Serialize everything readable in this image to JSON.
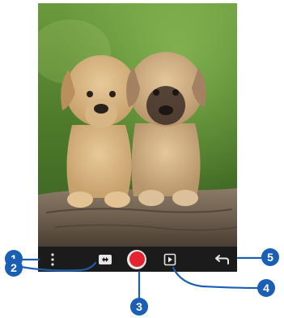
{
  "viewfinder": {
    "subject": "two-puppies-on-log"
  },
  "toolbar": {
    "buttons": [
      {
        "id": "menu",
        "icon": "vertical-dots-icon"
      },
      {
        "id": "switch-camera",
        "icon": "switch-camera-icon"
      },
      {
        "id": "shutter",
        "icon": "record-dot-icon"
      },
      {
        "id": "gallery",
        "icon": "play-thumbnail-icon"
      },
      {
        "id": "back",
        "icon": "back-arrow-icon"
      }
    ]
  },
  "callouts": {
    "c1": "1",
    "c2": "2",
    "c3": "3",
    "c4": "4",
    "c5": "5"
  },
  "colors": {
    "callout": "#1a5fb4",
    "shutter": "#e52330",
    "toolbar": "#1b1b1b"
  }
}
